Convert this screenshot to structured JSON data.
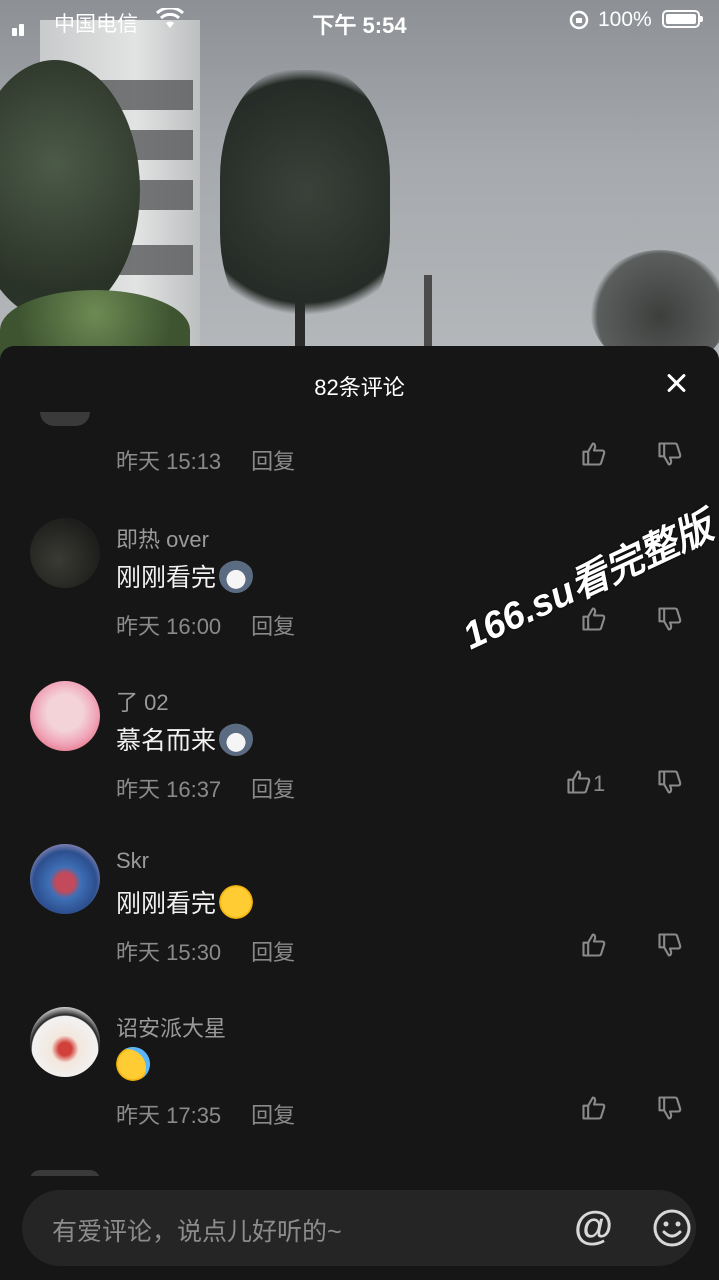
{
  "status_bar": {
    "carrier": "中国电信",
    "time": "下午 5:54",
    "battery": "100%"
  },
  "sheet": {
    "title": "82条评论"
  },
  "watermark": "166.su看完整版",
  "first_partial": {
    "time": "昨天 15:13",
    "reply": "回复"
  },
  "comments": [
    {
      "user": "即热 over",
      "text": "刚刚看完",
      "emoji": "husky-emoji",
      "time": "昨天 16:00",
      "reply": "回复",
      "likes": ""
    },
    {
      "user": "了 02",
      "text": "慕名而来",
      "emoji": "husky-emoji",
      "time": "昨天 16:37",
      "reply": "回复",
      "likes": "1"
    },
    {
      "user": "Skr",
      "text": "刚刚看完",
      "emoji": "laughing-tears-emoji",
      "time": "昨天 15:30",
      "reply": "回复",
      "likes": ""
    },
    {
      "user": "诏安派大星",
      "text": "",
      "emoji": "crying-emoji",
      "time": "昨天 17:35",
      "reply": "回复",
      "likes": ""
    }
  ],
  "input": {
    "placeholder": "有爱评论，说点儿好听的~",
    "at_symbol": "@"
  }
}
